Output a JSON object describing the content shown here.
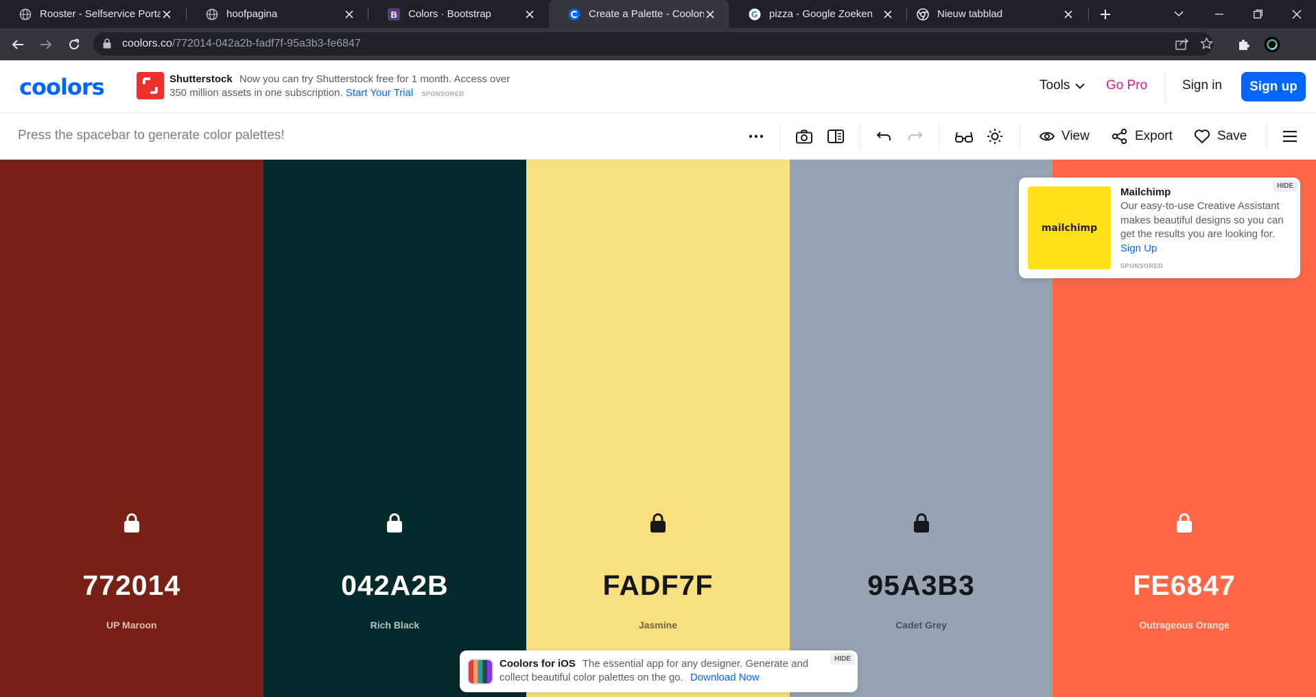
{
  "browser": {
    "tabs": [
      {
        "title": "Rooster - Selfservice Portal",
        "icon": "globe-icon",
        "active": false
      },
      {
        "title": "hoofpagina",
        "icon": "globe-icon",
        "active": false
      },
      {
        "title": "Colors · Bootstrap",
        "icon": "bootstrap-icon",
        "active": false
      },
      {
        "title": "Create a Palette - Coolors",
        "icon": "coolors-icon",
        "active": true
      },
      {
        "title": "pizza - Google Zoeken",
        "icon": "google-icon",
        "active": false
      },
      {
        "title": "Nieuw tabblad",
        "icon": "chrome-icon",
        "active": false
      }
    ],
    "url_host": "coolors.co",
    "url_path": "/772014-042a2b-fadf7f-95a3b3-fe6847"
  },
  "header": {
    "logo": "coolors",
    "ad": {
      "brand": "Shutterstock",
      "text": "Now you can try Shutterstock free for 1 month. Access over 350 million assets in one subscription.",
      "cta": "Start Your Trial",
      "sponsored": "SPONSORED"
    },
    "tools_label": "Tools",
    "gopro_label": "Go Pro",
    "signin_label": "Sign in",
    "signup_label": "Sign up"
  },
  "toolbar": {
    "hint": "Press the spacebar to generate color palettes!",
    "view_label": "View",
    "export_label": "Export",
    "save_label": "Save"
  },
  "palette": [
    {
      "hex": "772014",
      "name": "UP Maroon",
      "bg": "#772014",
      "fg": "#ffffff",
      "sub": "#e4bcb6"
    },
    {
      "hex": "042A2B",
      "name": "Rich Black",
      "bg": "#042a2b",
      "fg": "#ffffff",
      "sub": "#b3c2c2"
    },
    {
      "hex": "FADF7F",
      "name": "Jasmine",
      "bg": "#fadf7f",
      "fg": "#16161d",
      "sub": "#6b6140"
    },
    {
      "hex": "95A3B3",
      "name": "Cadet Grey",
      "bg": "#95a3b3",
      "fg": "#16161d",
      "sub": "#48505a"
    },
    {
      "hex": "FE6847",
      "name": "Outrageous Orange",
      "bg": "#fe6847",
      "fg": "#ffffff",
      "sub": "#ffe0d8"
    }
  ],
  "mailchimp_ad": {
    "image_text": "mailchimp",
    "title": "Mailchimp",
    "text": "Our easy-to-use Creative Assistant makes beautiful designs so you can get the results you are looking for.",
    "cta": "Sign Up",
    "sponsored": "SPONSORED",
    "hide": "HIDE"
  },
  "ios_banner": {
    "brand": "Coolors for iOS",
    "text": "The essential app for any designer. Generate and collect beautiful color palettes on the go.",
    "cta": "Download Now",
    "hide": "HIDE"
  }
}
